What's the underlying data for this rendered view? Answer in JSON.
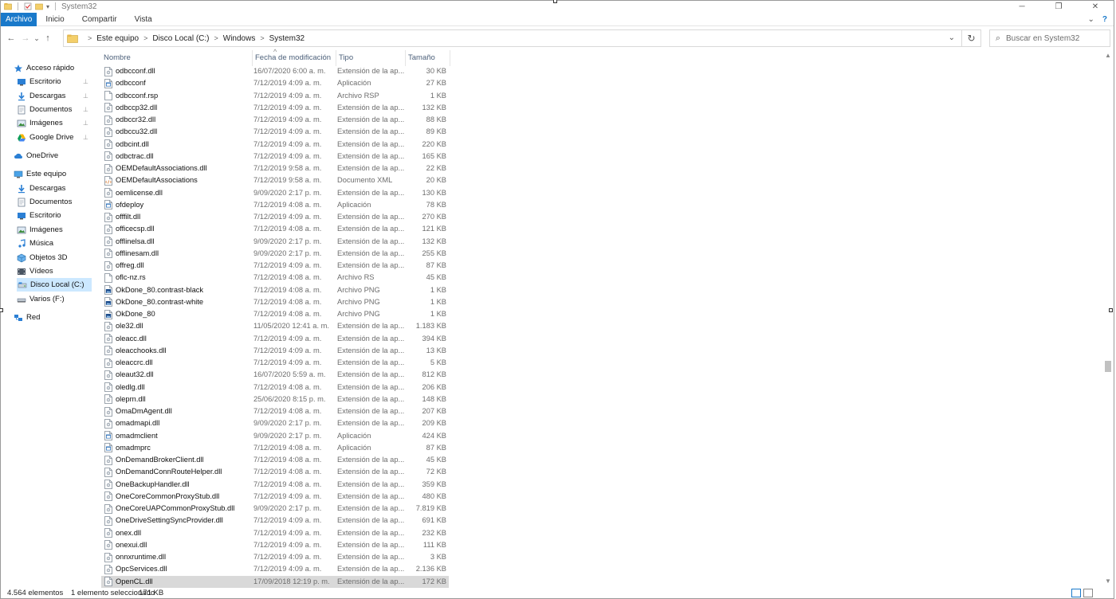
{
  "window": {
    "title": "System32",
    "controls": {
      "minimize": "─",
      "restore": "❐",
      "close": "✕"
    }
  },
  "ribbon": {
    "tabs": [
      "Archivo",
      "Inicio",
      "Compartir",
      "Vista"
    ],
    "expand_glyph": "⌄",
    "help_glyph": "?"
  },
  "nav": {
    "back": "←",
    "forward": "→",
    "recent": "⌄",
    "up": "↑",
    "breadcrumb": [
      "Este equipo",
      "Disco Local (C:)",
      "Windows",
      "System32"
    ],
    "dropdown": "⌄",
    "refresh": "↻"
  },
  "search": {
    "placeholder": "Buscar en System32",
    "icon": "⌕"
  },
  "navpane": {
    "items": [
      {
        "label": "Acceso rápido",
        "icon": "star-icon",
        "pinned": false,
        "level": 0
      },
      {
        "label": "Escritorio",
        "icon": "desktop-folder-icon",
        "pinned": true,
        "level": 1
      },
      {
        "label": "Descargas",
        "icon": "download-icon",
        "pinned": true,
        "level": 1
      },
      {
        "label": "Documentos",
        "icon": "documents-icon",
        "pinned": true,
        "level": 1
      },
      {
        "label": "Imágenes",
        "icon": "pictures-icon",
        "pinned": true,
        "level": 1
      },
      {
        "label": "Google Drive",
        "icon": "google-drive-icon",
        "pinned": true,
        "level": 1
      },
      {
        "label": "OneDrive",
        "icon": "cloud-icon",
        "pinned": false,
        "level": 0
      },
      {
        "label": "Este equipo",
        "icon": "computer-icon",
        "pinned": false,
        "level": 0
      },
      {
        "label": "Descargas",
        "icon": "download-icon",
        "pinned": false,
        "level": 1
      },
      {
        "label": "Documentos",
        "icon": "documents-icon",
        "pinned": false,
        "level": 1
      },
      {
        "label": "Escritorio",
        "icon": "desktop-folder-icon",
        "pinned": false,
        "level": 1
      },
      {
        "label": "Imágenes",
        "icon": "pictures-icon",
        "pinned": false,
        "level": 1
      },
      {
        "label": "Música",
        "icon": "music-icon",
        "pinned": false,
        "level": 1
      },
      {
        "label": "Objetos 3D",
        "icon": "objects-3d-icon",
        "pinned": false,
        "level": 1
      },
      {
        "label": "Vídeos",
        "icon": "videos-icon",
        "pinned": false,
        "level": 1
      },
      {
        "label": "Disco Local (C:)",
        "icon": "drive-icon",
        "pinned": false,
        "level": 1,
        "selected": true
      },
      {
        "label": "Varios (F:)",
        "icon": "usb-drive-icon",
        "pinned": false,
        "level": 1
      },
      {
        "label": "Red",
        "icon": "network-icon",
        "pinned": false,
        "level": 0
      }
    ],
    "pin_glyph": "📌"
  },
  "columns": {
    "name": "Nombre",
    "date": "Fecha de modificación",
    "type": "Tipo",
    "size": "Tamaño",
    "sort_glyph": "^"
  },
  "files": [
    {
      "name": "odbcconf.dll",
      "date": "16/07/2020 6:00 a. m.",
      "type": "Extensión de la ap...",
      "size": "30 KB",
      "icon": "dll-file-icon"
    },
    {
      "name": "odbcconf",
      "date": "7/12/2019 4:09 a. m.",
      "type": "Aplicación",
      "size": "27 KB",
      "icon": "exe-file-icon"
    },
    {
      "name": "odbcconf.rsp",
      "date": "7/12/2019 4:09 a. m.",
      "type": "Archivo RSP",
      "size": "1 KB",
      "icon": "blank-file-icon"
    },
    {
      "name": "odbccp32.dll",
      "date": "7/12/2019 4:09 a. m.",
      "type": "Extensión de la ap...",
      "size": "132 KB",
      "icon": "dll-file-icon"
    },
    {
      "name": "odbccr32.dll",
      "date": "7/12/2019 4:09 a. m.",
      "type": "Extensión de la ap...",
      "size": "88 KB",
      "icon": "dll-file-icon"
    },
    {
      "name": "odbccu32.dll",
      "date": "7/12/2019 4:09 a. m.",
      "type": "Extensión de la ap...",
      "size": "89 KB",
      "icon": "dll-file-icon"
    },
    {
      "name": "odbcint.dll",
      "date": "7/12/2019 4:09 a. m.",
      "type": "Extensión de la ap...",
      "size": "220 KB",
      "icon": "dll-file-icon"
    },
    {
      "name": "odbctrac.dll",
      "date": "7/12/2019 4:09 a. m.",
      "type": "Extensión de la ap...",
      "size": "165 KB",
      "icon": "dll-file-icon"
    },
    {
      "name": "OEMDefaultAssociations.dll",
      "date": "7/12/2019 9:58 a. m.",
      "type": "Extensión de la ap...",
      "size": "22 KB",
      "icon": "dll-file-icon"
    },
    {
      "name": "OEMDefaultAssociations",
      "date": "7/12/2019 9:58 a. m.",
      "type": "Documento XML",
      "size": "20 KB",
      "icon": "xml-file-icon"
    },
    {
      "name": "oemlicense.dll",
      "date": "9/09/2020 2:17 p. m.",
      "type": "Extensión de la ap...",
      "size": "130 KB",
      "icon": "dll-file-icon"
    },
    {
      "name": "ofdeploy",
      "date": "7/12/2019 4:08 a. m.",
      "type": "Aplicación",
      "size": "78 KB",
      "icon": "exe-file-icon"
    },
    {
      "name": "offfilt.dll",
      "date": "7/12/2019 4:09 a. m.",
      "type": "Extensión de la ap...",
      "size": "270 KB",
      "icon": "dll-file-icon"
    },
    {
      "name": "officecsp.dll",
      "date": "7/12/2019 4:08 a. m.",
      "type": "Extensión de la ap...",
      "size": "121 KB",
      "icon": "dll-file-icon"
    },
    {
      "name": "offlinelsa.dll",
      "date": "9/09/2020 2:17 p. m.",
      "type": "Extensión de la ap...",
      "size": "132 KB",
      "icon": "dll-file-icon"
    },
    {
      "name": "offlinesam.dll",
      "date": "9/09/2020 2:17 p. m.",
      "type": "Extensión de la ap...",
      "size": "255 KB",
      "icon": "dll-file-icon"
    },
    {
      "name": "offreg.dll",
      "date": "7/12/2019 4:09 a. m.",
      "type": "Extensión de la ap...",
      "size": "87 KB",
      "icon": "dll-file-icon"
    },
    {
      "name": "oflc-nz.rs",
      "date": "7/12/2019 4:08 a. m.",
      "type": "Archivo RS",
      "size": "45 KB",
      "icon": "blank-file-icon"
    },
    {
      "name": "OkDone_80.contrast-black",
      "date": "7/12/2019 4:08 a. m.",
      "type": "Archivo PNG",
      "size": "1 KB",
      "icon": "png-file-icon"
    },
    {
      "name": "OkDone_80.contrast-white",
      "date": "7/12/2019 4:08 a. m.",
      "type": "Archivo PNG",
      "size": "1 KB",
      "icon": "png-file-icon"
    },
    {
      "name": "OkDone_80",
      "date": "7/12/2019 4:08 a. m.",
      "type": "Archivo PNG",
      "size": "1 KB",
      "icon": "png-file-icon"
    },
    {
      "name": "ole32.dll",
      "date": "11/05/2020 12:41 a. m.",
      "type": "Extensión de la ap...",
      "size": "1.183 KB",
      "icon": "dll-file-icon"
    },
    {
      "name": "oleacc.dll",
      "date": "7/12/2019 4:09 a. m.",
      "type": "Extensión de la ap...",
      "size": "394 KB",
      "icon": "dll-file-icon"
    },
    {
      "name": "oleacchooks.dll",
      "date": "7/12/2019 4:09 a. m.",
      "type": "Extensión de la ap...",
      "size": "13 KB",
      "icon": "dll-file-icon"
    },
    {
      "name": "oleaccrc.dll",
      "date": "7/12/2019 4:09 a. m.",
      "type": "Extensión de la ap...",
      "size": "5 KB",
      "icon": "dll-file-icon"
    },
    {
      "name": "oleaut32.dll",
      "date": "16/07/2020 5:59 a. m.",
      "type": "Extensión de la ap...",
      "size": "812 KB",
      "icon": "dll-file-icon"
    },
    {
      "name": "oledlg.dll",
      "date": "7/12/2019 4:08 a. m.",
      "type": "Extensión de la ap...",
      "size": "206 KB",
      "icon": "dll-file-icon"
    },
    {
      "name": "oleprn.dll",
      "date": "25/06/2020 8:15 p. m.",
      "type": "Extensión de la ap...",
      "size": "148 KB",
      "icon": "dll-file-icon"
    },
    {
      "name": "OmaDmAgent.dll",
      "date": "7/12/2019 4:08 a. m.",
      "type": "Extensión de la ap...",
      "size": "207 KB",
      "icon": "dll-file-icon"
    },
    {
      "name": "omadmapi.dll",
      "date": "9/09/2020 2:17 p. m.",
      "type": "Extensión de la ap...",
      "size": "209 KB",
      "icon": "dll-file-icon"
    },
    {
      "name": "omadmclient",
      "date": "9/09/2020 2:17 p. m.",
      "type": "Aplicación",
      "size": "424 KB",
      "icon": "exe-file-icon"
    },
    {
      "name": "omadmprc",
      "date": "7/12/2019 4:08 a. m.",
      "type": "Aplicación",
      "size": "87 KB",
      "icon": "exe-file-icon"
    },
    {
      "name": "OnDemandBrokerClient.dll",
      "date": "7/12/2019 4:08 a. m.",
      "type": "Extensión de la ap...",
      "size": "45 KB",
      "icon": "dll-file-icon"
    },
    {
      "name": "OnDemandConnRouteHelper.dll",
      "date": "7/12/2019 4:08 a. m.",
      "type": "Extensión de la ap...",
      "size": "72 KB",
      "icon": "dll-file-icon"
    },
    {
      "name": "OneBackupHandler.dll",
      "date": "7/12/2019 4:08 a. m.",
      "type": "Extensión de la ap...",
      "size": "359 KB",
      "icon": "dll-file-icon"
    },
    {
      "name": "OneCoreCommonProxyStub.dll",
      "date": "7/12/2019 4:09 a. m.",
      "type": "Extensión de la ap...",
      "size": "480 KB",
      "icon": "dll-file-icon"
    },
    {
      "name": "OneCoreUAPCommonProxyStub.dll",
      "date": "9/09/2020 2:17 p. m.",
      "type": "Extensión de la ap...",
      "size": "7.819 KB",
      "icon": "dll-file-icon"
    },
    {
      "name": "OneDriveSettingSyncProvider.dll",
      "date": "7/12/2019 4:09 a. m.",
      "type": "Extensión de la ap...",
      "size": "691 KB",
      "icon": "dll-file-icon"
    },
    {
      "name": "onex.dll",
      "date": "7/12/2019 4:09 a. m.",
      "type": "Extensión de la ap...",
      "size": "232 KB",
      "icon": "dll-file-icon"
    },
    {
      "name": "onexui.dll",
      "date": "7/12/2019 4:09 a. m.",
      "type": "Extensión de la ap...",
      "size": "111 KB",
      "icon": "dll-file-icon"
    },
    {
      "name": "onnxruntime.dll",
      "date": "7/12/2019 4:09 a. m.",
      "type": "Extensión de la ap...",
      "size": "3 KB",
      "icon": "dll-file-icon"
    },
    {
      "name": "OpcServices.dll",
      "date": "7/12/2019 4:09 a. m.",
      "type": "Extensión de la ap...",
      "size": "2.136 KB",
      "icon": "dll-file-icon"
    },
    {
      "name": "OpenCL.dll",
      "date": "17/09/2018 12:19 p. m.",
      "type": "Extensión de la ap...",
      "size": "172 KB",
      "icon": "dll-file-icon",
      "selected": true
    }
  ],
  "status": {
    "count": "4.564 elementos",
    "selection": "1 elemento seleccionado",
    "size": "171 KB"
  },
  "scrollbar": {
    "up": "▲",
    "down": "▼"
  },
  "colors": {
    "accent": "#1979ca",
    "selected_nav": "#cce8ff",
    "selected_row": "#d9d9d9",
    "secondary_text": "#6d6d6d"
  }
}
